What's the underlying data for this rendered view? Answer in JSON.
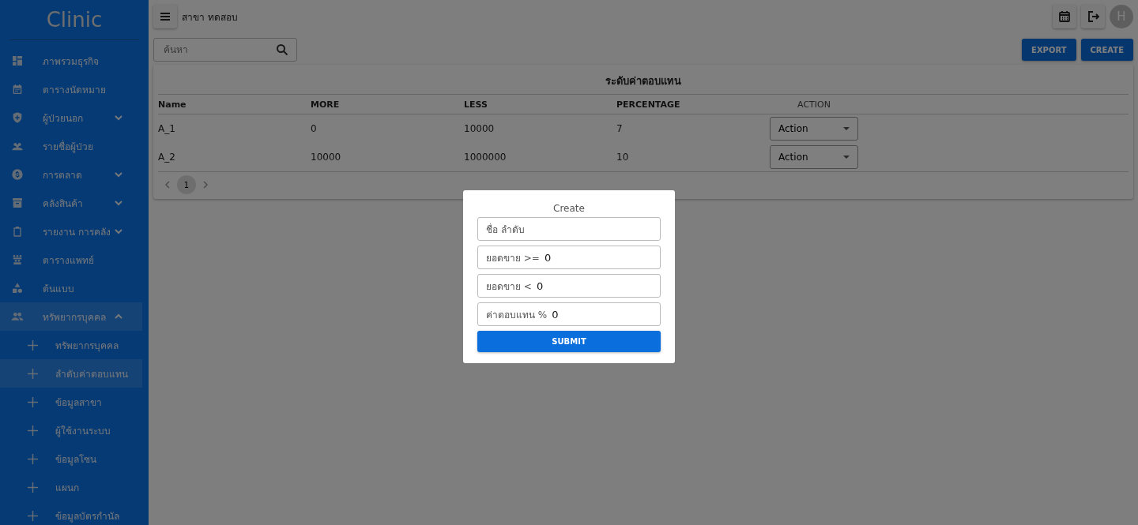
{
  "sidebar": {
    "logo": "Clinic",
    "items": [
      {
        "label": "ภาพรวมธุรกิจ",
        "kind": "link",
        "selected": false
      },
      {
        "label": "ตารางนัดหมาย",
        "kind": "link",
        "selected": false
      },
      {
        "label": "ผู้ป่วยนอก",
        "kind": "group",
        "expanded": false,
        "selected": false
      },
      {
        "label": "รายชื่อผู้ป่วย",
        "kind": "link",
        "selected": false
      },
      {
        "label": "การตลาด",
        "kind": "group",
        "expanded": false,
        "selected": false
      },
      {
        "label": "คลังสินค้า",
        "kind": "group",
        "expanded": false,
        "selected": false
      },
      {
        "label": "รายงาน การคลัง",
        "kind": "group",
        "expanded": false,
        "selected": false
      },
      {
        "label": "ตารางแพทย์",
        "kind": "link",
        "selected": false
      },
      {
        "label": "ต้นแบบ",
        "kind": "link",
        "selected": false
      },
      {
        "label": "ทรัพยากรบุคคล",
        "kind": "group",
        "expanded": true,
        "selected": true,
        "children": [
          {
            "label": "ทรัพยากรบุคคล",
            "selected": false
          },
          {
            "label": "ลำดับค่าตอบแทน",
            "selected": true
          },
          {
            "label": "ข้อมูลสาขา",
            "selected": false
          },
          {
            "label": "ผู้ใช้งานระบบ",
            "selected": false
          },
          {
            "label": "ข้อมูลโซน",
            "selected": false
          },
          {
            "label": "แผนก",
            "selected": false
          },
          {
            "label": "ข้อมูลบัตรกำนัล",
            "selected": false
          }
        ]
      }
    ]
  },
  "topbar": {
    "branch": "สาขา ทดสอบ",
    "avatar": "H"
  },
  "search": {
    "placeholder": "ค้นหา"
  },
  "buttons": [
    "EXPORT",
    "CREATE"
  ],
  "table": {
    "title": "ระดับค่าตอบแทน",
    "columns": [
      "Name",
      "MORE",
      "LESS",
      "PERCENTAGE",
      "ACTION"
    ],
    "rows": [
      {
        "cells": [
          "A_1",
          "0",
          "10000",
          "7"
        ],
        "action": "Action"
      },
      {
        "cells": [
          "A_2",
          "10000",
          "1000000",
          "10"
        ],
        "action": "Action"
      }
    ],
    "pages": [
      {
        "label": "1",
        "selected": true
      }
    ]
  },
  "modal": {
    "title": "Create",
    "fields": [
      {
        "placeholder": "ชื่อ ลำดับ"
      },
      {
        "label": "ยอดขาย >=",
        "value": "0"
      },
      {
        "label": "ยอดขาย <",
        "value": "0"
      },
      {
        "label": "ค่าตอบแทน %",
        "value": "0"
      }
    ],
    "submit": "SUBMIT"
  }
}
